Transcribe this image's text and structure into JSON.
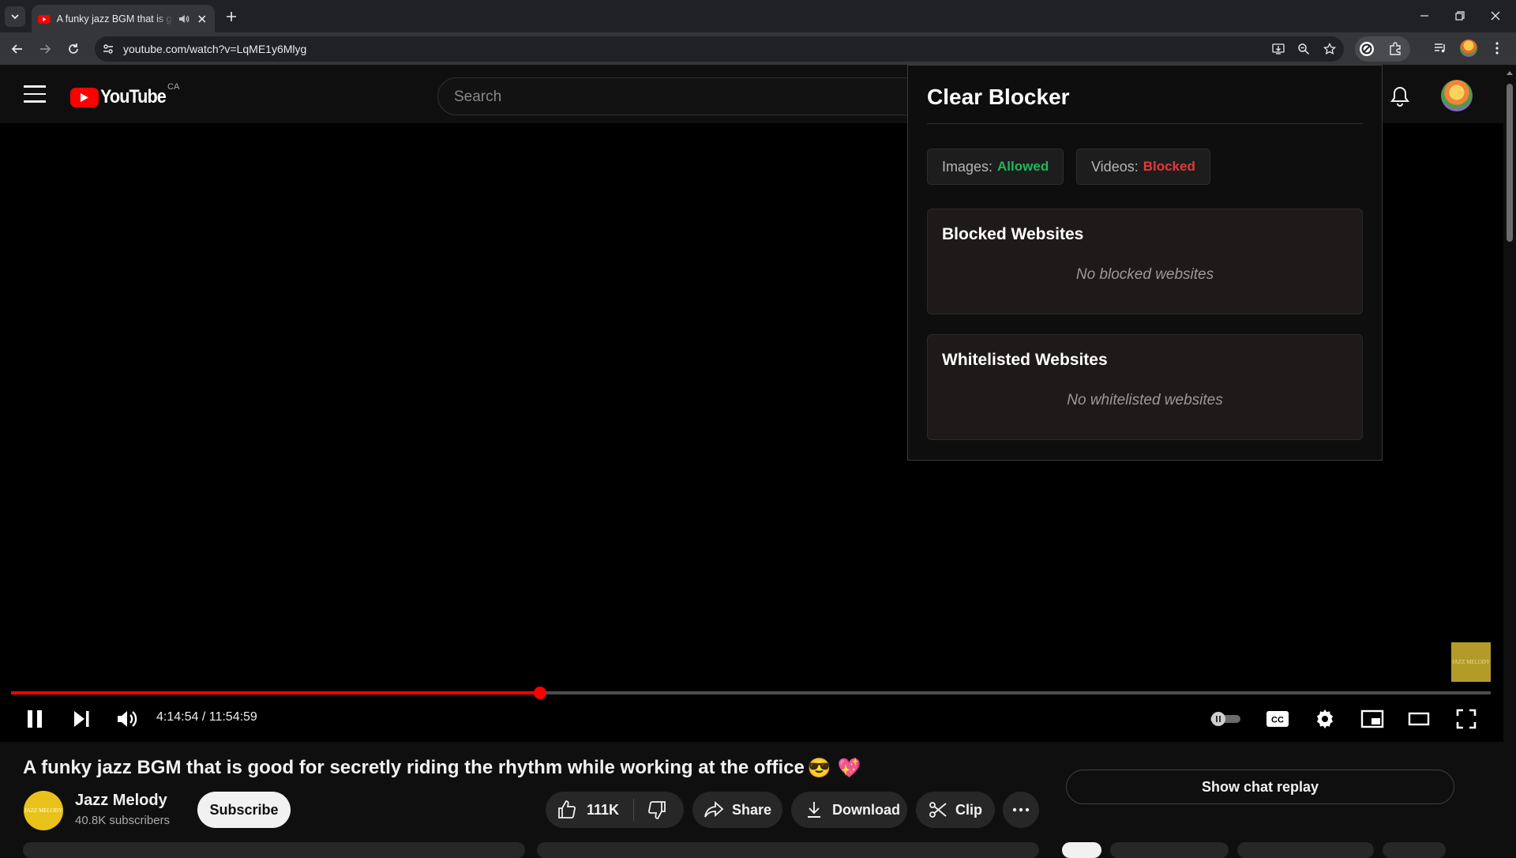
{
  "browser": {
    "tab": {
      "title": "A funky jazz BGM that is good for secretly riding the rhythm while working at the office"
    },
    "url": "youtube.com/watch?v=LqME1y6Mlyg"
  },
  "youtube": {
    "country": "CA",
    "logo_text": "YouTube",
    "search_placeholder": "Search"
  },
  "player": {
    "time_current": "4:14:54",
    "time_separator": " / ",
    "time_total": "11:54:59",
    "progress_fraction": 0.3575,
    "watermark_text": "JAZZ MELODY"
  },
  "video": {
    "title": "A funky jazz BGM that is good for secretly riding the rhythm while working at the office",
    "title_emojis": [
      "😎",
      "💖"
    ],
    "channel_name": "Jazz Melody",
    "channel_avatar_text": "JAZZ MELODY",
    "subscribers": "40.8K subscribers",
    "subscribe_label": "Subscribe",
    "likes": "111K",
    "share_label": "Share",
    "download_label": "Download",
    "clip_label": "Clip",
    "chat_replay_label": "Show chat replay"
  },
  "popup": {
    "title": "Clear Blocker",
    "images_label": "Images:",
    "images_value": "Allowed",
    "videos_label": "Videos:",
    "videos_value": "Blocked",
    "blocked_title": "Blocked Websites",
    "blocked_empty": "No blocked websites",
    "whitelisted_title": "Whitelisted Websites",
    "whitelisted_empty": "No whitelisted websites"
  },
  "colors": {
    "allowed": "#1db85a",
    "blocked": "#e53935",
    "youtube_red": "#ff0000"
  }
}
